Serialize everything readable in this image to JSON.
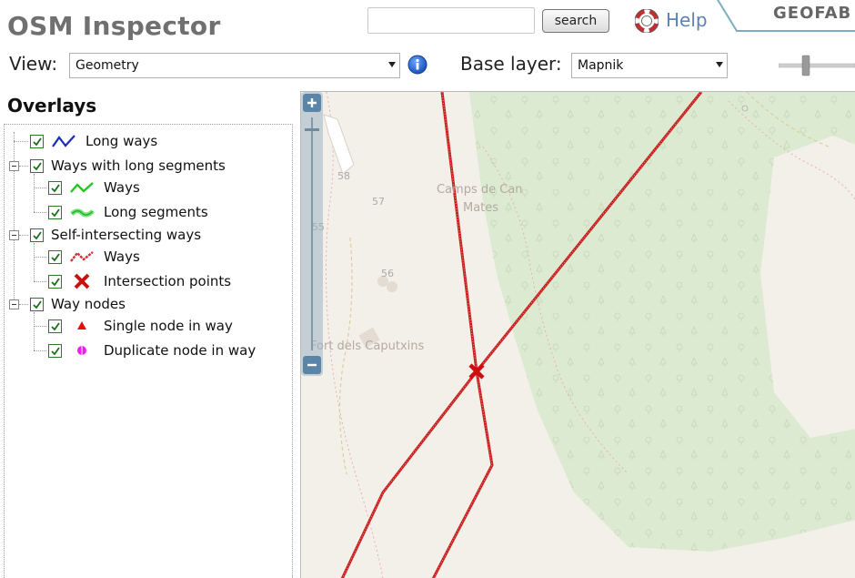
{
  "header": {
    "app_title": "OSM Inspector",
    "search_placeholder": "",
    "search_button": "search",
    "help_link": "Help",
    "geofabrik_label": "GEOFAB",
    "view_label": "View:",
    "view_selected": "Geometry",
    "base_layer_label": "Base layer:",
    "base_layer_selected": "Mapnik"
  },
  "overlays": {
    "title": "Overlays",
    "items": [
      {
        "label": "Long ways",
        "checked": true,
        "icon": "blue-wave-icon"
      },
      {
        "label": "Ways with long segments",
        "checked": true,
        "group": true
      },
      {
        "label": "Ways",
        "checked": true,
        "icon": "green-wave-icon"
      },
      {
        "label": "Long segments",
        "checked": true,
        "icon": "green-thick-wave-icon"
      },
      {
        "label": "Self-intersecting ways",
        "checked": true,
        "group": true
      },
      {
        "label": "Ways",
        "checked": true,
        "icon": "red-wave-icon"
      },
      {
        "label": "Intersection points",
        "checked": true,
        "icon": "red-x-icon"
      },
      {
        "label": "Way nodes",
        "checked": true,
        "group": true
      },
      {
        "label": "Single node in way",
        "checked": true,
        "icon": "red-triangle-icon"
      },
      {
        "label": "Duplicate node in way",
        "checked": true,
        "icon": "magenta-dot-icon"
      }
    ]
  },
  "map": {
    "labels": {
      "campus_1": "Camps de Can",
      "campus_2": "Mates",
      "fort": "Fort dels Caputxins",
      "n58": "58",
      "n57": "57",
      "n56": "56",
      "n55": "55"
    },
    "zoom_in": "+",
    "zoom_out": "−"
  },
  "colors": {
    "way_red": "#c81e1e",
    "forest_green": "#dcead2",
    "map_background": "#f3efe9",
    "title_gray": "#707070",
    "help_blue": "#5a82b4"
  }
}
